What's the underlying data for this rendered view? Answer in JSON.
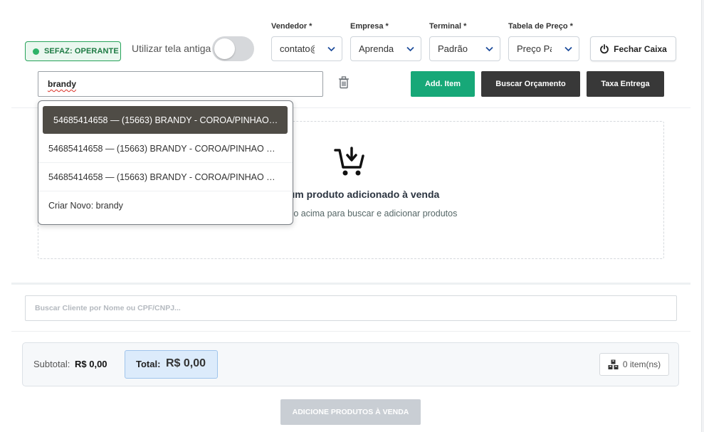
{
  "status": {
    "sefaz_label": "SEFAZ: OPERANTE",
    "sefaz_color": "#27a35a"
  },
  "toggle_old_screen": {
    "label": "Utilizar tela antiga",
    "on": false
  },
  "fields": {
    "vendedor": {
      "label": "Vendedor *",
      "value": "contato@a"
    },
    "empresa": {
      "label": "Empresa *",
      "value": "Aprenda E"
    },
    "terminal": {
      "label": "Terminal *",
      "value": "Padrão"
    },
    "tabela": {
      "label": "Tabela de Preço *",
      "value": "Preço Pad"
    }
  },
  "close_register_button": {
    "label": "Fechar Caixa",
    "icon": "power-icon"
  },
  "product_search": {
    "value": "brandy"
  },
  "actions": {
    "add_item": "Add. Item",
    "search_quote": "Buscar Orçamento",
    "delivery_fee": "Taxa Entrega"
  },
  "suggestions": [
    "54685414658 — (15663) BRANDY - COROA/PINHAO WEBER",
    "54685414658 — (15663) BRANDY - COROA/PINHAO WEBER",
    "54685414658 — (15663) BRANDY - COROA/PINHAO WEBER",
    "Criar Novo: brandy"
  ],
  "empty_state": {
    "title": "Nenhum produto adicionado à venda",
    "subtitle": "Use o campo acima para buscar e adicionar produtos",
    "icon": "cart-download-icon"
  },
  "client_search": {
    "placeholder": "Buscar Cliente por Nome ou CPF/CNPJ..."
  },
  "totals": {
    "subtotal_label": "Subtotal:",
    "subtotal_value": "R$ 0,00",
    "total_label": "Total:",
    "total_value": "R$ 0,00",
    "items_count": "0 item(ns)"
  },
  "finish_button": {
    "label": "ADICIONE PRODUTOS À VENDA"
  },
  "colors": {
    "accent_green": "#17a878",
    "dark_button": "#383838",
    "active_suggestion": "#4f4c46"
  }
}
